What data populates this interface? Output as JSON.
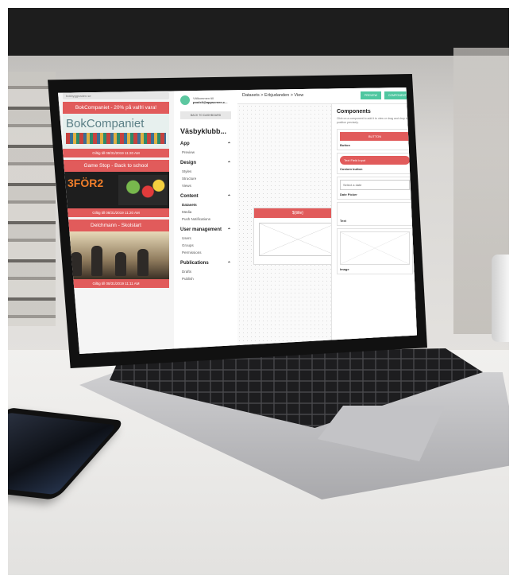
{
  "mobile": {
    "url": "bokbyggnaden.se",
    "cards": [
      {
        "title": "BokCompaniet - 20% på valfri vara!",
        "brand": "BokCompaniet",
        "footer": "Giltig till 08/31/2019 11:20 AM"
      },
      {
        "title": "Game Stop - Back to school",
        "brand": "3FÖR2",
        "footer": "Giltig till 08/31/2019 11:20 AM"
      },
      {
        "title": "Delchmann - Skolstart",
        "footer": "Giltig till 08/31/2019 11:11 AM"
      }
    ]
  },
  "nav": {
    "profile_line1": "Välkommen till",
    "profile_line2": "poolcli@appscreen.c...",
    "back_label": "BACK TO DASHBOARD",
    "site_title": "Väsbyklubb...",
    "sections": [
      {
        "title": "App",
        "items": [
          "Preview"
        ]
      },
      {
        "title": "Design",
        "items": [
          "Styles",
          "Structure",
          "Views"
        ]
      },
      {
        "title": "Content",
        "items": [
          "Datasets",
          "Media",
          "Push Notifications"
        ]
      },
      {
        "title": "User management",
        "items": [
          "Users",
          "Groups",
          "Permissions"
        ]
      },
      {
        "title": "Publications",
        "items": [
          "Drafts",
          "Publish"
        ]
      }
    ]
  },
  "main": {
    "breadcrumb": "Datasets > Erbjudanden > View",
    "preview_label": "PREVIEW",
    "components_btn": "COMPONENTS",
    "device_title": "${title}"
  },
  "components": {
    "title": "Components",
    "close": "×",
    "description": "Click on a component to add it to view or drag and drop to position precisely.",
    "items": [
      "BUTTON",
      "Button",
      "Text Field Input",
      "Custom button",
      "Select a date",
      "Date Picker",
      "Text",
      "Image"
    ]
  }
}
